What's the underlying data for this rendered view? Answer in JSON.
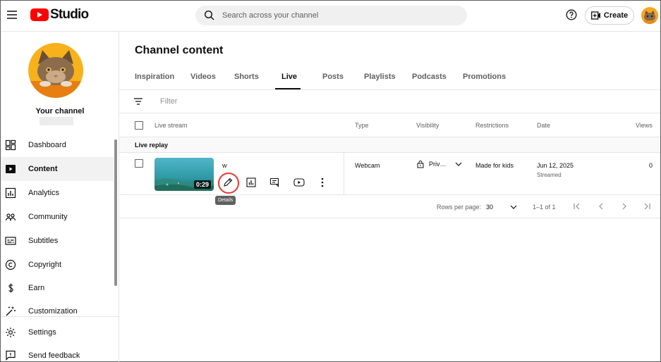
{
  "header": {
    "logo_text": "Studio",
    "search_placeholder": "Search across your channel",
    "create_label": "Create"
  },
  "sidebar": {
    "channel_label": "Your channel",
    "items": [
      {
        "label": "Dashboard",
        "icon": "dashboard-icon"
      },
      {
        "label": "Content",
        "icon": "content-icon",
        "active": true
      },
      {
        "label": "Analytics",
        "icon": "analytics-icon"
      },
      {
        "label": "Community",
        "icon": "community-icon"
      },
      {
        "label": "Subtitles",
        "icon": "subtitles-icon"
      },
      {
        "label": "Copyright",
        "icon": "copyright-icon"
      },
      {
        "label": "Earn",
        "icon": "earn-icon"
      },
      {
        "label": "Customization",
        "icon": "customization-icon"
      }
    ],
    "bottom_items": [
      {
        "label": "Settings",
        "icon": "gear-icon"
      },
      {
        "label": "Send feedback",
        "icon": "feedback-icon"
      }
    ]
  },
  "main": {
    "title": "Channel content",
    "tabs": [
      "Inspiration",
      "Videos",
      "Shorts",
      "Live",
      "Posts",
      "Playlists",
      "Podcasts",
      "Promotions"
    ],
    "active_tab": "Live",
    "filter_placeholder": "Filter",
    "columns": {
      "live_stream": "Live stream",
      "type": "Type",
      "visibility": "Visibility",
      "restrictions": "Restrictions",
      "date": "Date",
      "views": "Views"
    },
    "group_label": "Live replay",
    "rows": [
      {
        "title": "w",
        "duration": "0:29",
        "type": "Webcam",
        "visibility": "Priv…",
        "restrictions": "Made for kids",
        "date": "Jun 12, 2025",
        "date_status": "Streamed",
        "views": "0"
      }
    ],
    "tooltip": "Details",
    "pagination": {
      "rows_per_page_label": "Rows per page:",
      "rows_per_page": "30",
      "range": "1–1 of 1"
    }
  },
  "colors": {
    "brand_red": "#ff0000",
    "highlight_red": "#e53935",
    "avatar_orange": "#f5a623"
  }
}
